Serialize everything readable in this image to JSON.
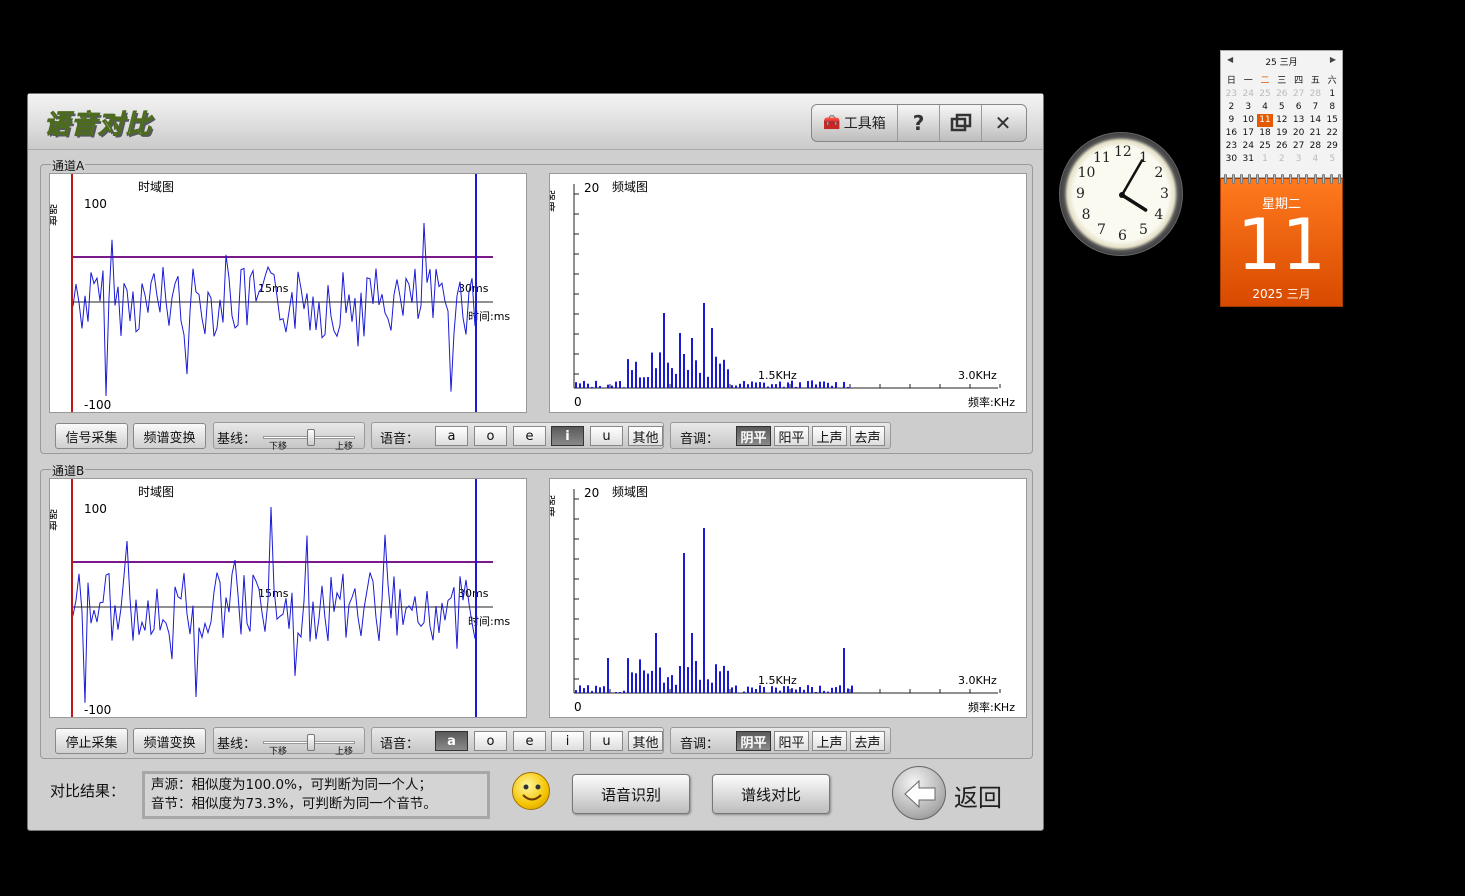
{
  "window": {
    "title": "语音对比"
  },
  "toolbar": {
    "tool_label": "工具箱",
    "help_label": "?",
    "restore_label": "🗗",
    "close_label": "✕"
  },
  "channels": [
    {
      "label": "通道A",
      "time_plot": {
        "title": "时域图",
        "ylabel": "强度",
        "ymax": "100",
        "ymin": "-100",
        "tick_mid": "15ms",
        "tick_end": "30ms",
        "xlabel": "时间:ms"
      },
      "freq_plot": {
        "title": "频域图",
        "ylabel": "强度",
        "ymax": "20",
        "xmin": "0",
        "tick_mid": "1.5KHz",
        "tick_end": "3.0KHz",
        "xlabel": "频率:KHz"
      },
      "capture_button": "信号采集",
      "fft_button": "频谱变换",
      "baseline_label": "基线：",
      "slider_low": "下移",
      "slider_high": "上移",
      "vowel_label": "语音：",
      "vowels": [
        "a",
        "o",
        "e",
        "i",
        "u",
        "其他"
      ],
      "vowel_selected": 3,
      "tone_label": "音调：",
      "tones": [
        "阴平",
        "阳平",
        "上声",
        "去声"
      ],
      "tone_selected": 0
    },
    {
      "label": "通道B",
      "time_plot": {
        "title": "时域图",
        "ylabel": "强度",
        "ymax": "100",
        "ymin": "-100",
        "tick_mid": "15ms",
        "tick_end": "30ms",
        "xlabel": "时间:ms"
      },
      "freq_plot": {
        "title": "频域图",
        "ylabel": "强度",
        "ymax": "20",
        "xmin": "0",
        "tick_mid": "1.5KHz",
        "tick_end": "3.0KHz",
        "xlabel": "频率:KHz"
      },
      "capture_button": "停止采集",
      "fft_button": "频谱变换",
      "baseline_label": "基线：",
      "slider_low": "下移",
      "slider_high": "上移",
      "vowel_label": "语音：",
      "vowels": [
        "a",
        "o",
        "e",
        "i",
        "u",
        "其他"
      ],
      "vowel_selected": 0,
      "tone_label": "音调：",
      "tones": [
        "阴平",
        "阳平",
        "上声",
        "去声"
      ],
      "tone_selected": 0
    }
  ],
  "result": {
    "label": "对比结果：",
    "line1": "声源：相似度为100.0%，可判断为同一个人；",
    "line2": "音节：相似度为73.3%，可判断为同一个音节。",
    "recognize_button": "语音识别",
    "compare_button": "谱线对比",
    "back_label": "返回"
  },
  "calendar": {
    "header": "25 三月",
    "weekdays": [
      "日",
      "一",
      "二",
      "三",
      "四",
      "五",
      "六"
    ],
    "weeks": [
      [
        "23",
        "24",
        "25",
        "26",
        "27",
        "28",
        "1"
      ],
      [
        "2",
        "3",
        "4",
        "5",
        "6",
        "7",
        "8"
      ],
      [
        "9",
        "10",
        "11",
        "12",
        "13",
        "14",
        "15"
      ],
      [
        "16",
        "17",
        "18",
        "19",
        "20",
        "21",
        "22"
      ],
      [
        "23",
        "24",
        "25",
        "26",
        "27",
        "28",
        "29"
      ],
      [
        "30",
        "31",
        "1",
        "2",
        "3",
        "4",
        "5"
      ]
    ],
    "weekday_name": "星期二",
    "day": "11",
    "month_year": "2025 三月"
  },
  "clock": {
    "numbers": [
      "12",
      "1",
      "2",
      "3",
      "4",
      "5",
      "6",
      "7",
      "8",
      "9",
      "10",
      "11"
    ],
    "hour": 4,
    "minute": 5
  }
}
